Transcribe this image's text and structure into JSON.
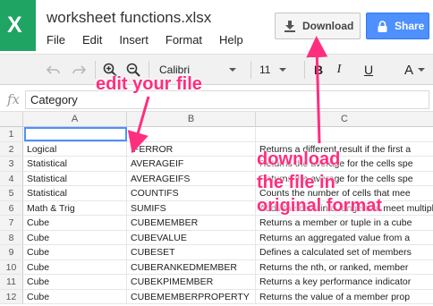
{
  "app": {
    "logo_letter": "X",
    "brand_color": "#1fa463",
    "file_title": "worksheet functions.xlsx"
  },
  "menu": [
    "File",
    "Edit",
    "Insert",
    "Format",
    "Help"
  ],
  "buttons": {
    "download_label": "Download",
    "share_label": "Share"
  },
  "toolbar": {
    "undo_icon": "undo-icon",
    "redo_icon": "redo-icon",
    "zoom_in_icon": "zoom-in-icon",
    "zoom_out_icon": "zoom-out-icon",
    "font_family": "Calibri",
    "font_size": "11",
    "bold_label": "B",
    "italic_label": "I",
    "underline_label": "U",
    "text_color_label": "A"
  },
  "formula_bar": {
    "fx_label": "fx",
    "value": "Category"
  },
  "columns": [
    "A",
    "B",
    "C"
  ],
  "rows": [
    {
      "n": "1",
      "a": "",
      "b": "",
      "c": ""
    },
    {
      "n": "2",
      "a": "Logical",
      "b": "IFERROR",
      "c": "Returns a different result if the first a"
    },
    {
      "n": "3",
      "a": "Statistical",
      "b": "AVERAGEIF",
      "c": "Returns the average for the cells spe"
    },
    {
      "n": "4",
      "a": "Statistical",
      "b": "AVERAGEIFS",
      "c": "Returns the average for the cells spe"
    },
    {
      "n": "5",
      "a": "Statistical",
      "b": "COUNTIFS",
      "c": "Counts the number of cells that mee"
    },
    {
      "n": "6",
      "a": "Math & Trig",
      "b": "SUMIFS",
      "c": "Adds the cells in a range that meet multiple"
    },
    {
      "n": "7",
      "a": "Cube",
      "b": "CUBEMEMBER",
      "c": "Returns a member or tuple in a cube"
    },
    {
      "n": "8",
      "a": "Cube",
      "b": "CUBEVALUE",
      "c": "Returns an aggregated value from a"
    },
    {
      "n": "9",
      "a": "Cube",
      "b": "CUBESET",
      "c": "Defines a calculated set of members"
    },
    {
      "n": "10",
      "a": "Cube",
      "b": "CUBERANKEDMEMBER",
      "c": "Returns the nth, or ranked, member"
    },
    {
      "n": "11",
      "a": "Cube",
      "b": "CUBEKPIMEMBER",
      "c": "Returns a key performance indicator"
    },
    {
      "n": "12",
      "a": "Cube",
      "b": "CUBEMEMBERPROPERTY",
      "c": "Returns the value of a member prop"
    }
  ],
  "annotations": {
    "edit": "edit your file",
    "download_line1": "download",
    "download_line2": "the file in",
    "download_line3": "original format",
    "color": "#ff2e7e"
  }
}
